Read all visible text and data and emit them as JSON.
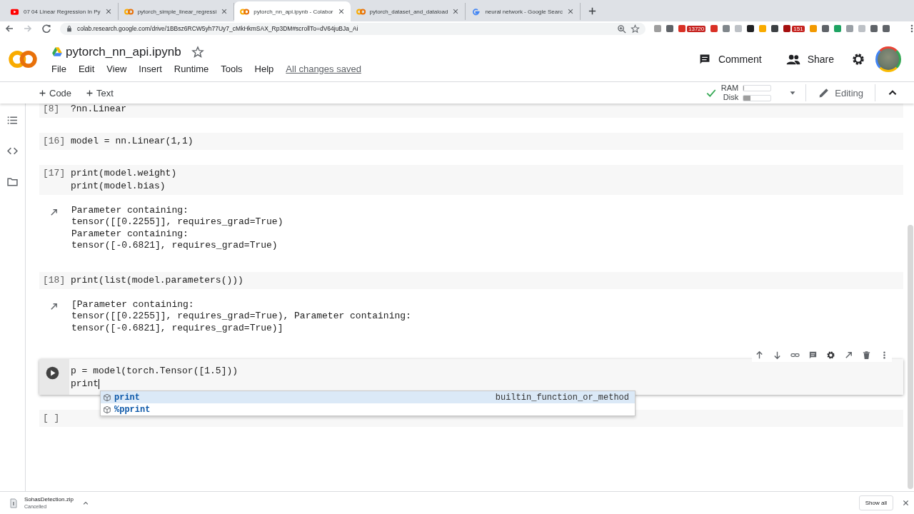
{
  "browser": {
    "tabs": [
      {
        "kind": "video",
        "title": "07 04 Linear Regression In Py",
        "selected": false
      },
      {
        "kind": "colab",
        "title": "pytorch_simple_linear_regressi",
        "selected": false
      },
      {
        "kind": "colab",
        "title": "pytorch_nn_api.ipynb - Colabor",
        "selected": true
      },
      {
        "kind": "colab",
        "title": "pytorch_dataset_and_dataload",
        "selected": false
      },
      {
        "kind": "google",
        "title": "neural network - Google Searc",
        "selected": false
      }
    ],
    "address": "colab.research.google.com/drive/1BBsz6RCW5yh77Uy7_cMkHkmSAX_Rp3DM#scrollTo=dV64juBJa_Ai",
    "extensions": [
      {
        "color": "#9e9e9e"
      },
      {
        "color": "#5f6368"
      },
      {
        "color": "#d93025",
        "badge": "13720"
      },
      {
        "color": "#d93025"
      },
      {
        "color": "#80868b"
      },
      {
        "color": "#bdc1c6"
      },
      {
        "color": "#202124"
      },
      {
        "color": "#f9ab00"
      },
      {
        "color": "#3c4043"
      },
      {
        "color": "#a50e0e",
        "badge": "151"
      },
      {
        "color": "#f29900"
      },
      {
        "color": "#5f6368"
      },
      {
        "color": "#1ea362"
      },
      {
        "color": "#9aa0a6"
      },
      {
        "color": "#bdc1c6"
      },
      {
        "color": "#5f6368"
      },
      {
        "color": "#5f6368"
      }
    ]
  },
  "header": {
    "title": "pytorch_nn_api.ipynb",
    "starred": false,
    "menus": [
      "File",
      "Edit",
      "View",
      "Insert",
      "Runtime",
      "Tools",
      "Help"
    ],
    "save_status": "All changes saved",
    "comment": "Comment",
    "share": "Share"
  },
  "toolbar": {
    "add_buttons": [
      "Code",
      "Text"
    ],
    "connected": true,
    "ram": {
      "label": "RAM",
      "level": 0.03
    },
    "disk": {
      "label": "Disk",
      "level": 0.25
    },
    "mode": "Editing"
  },
  "cells": [
    {
      "kind": "code",
      "prompt": "[8]",
      "lines": [
        "?nn.Linear"
      ]
    },
    {
      "kind": "code",
      "prompt": "[16]",
      "lines": [
        "model = nn.Linear(1,1)"
      ]
    },
    {
      "kind": "code",
      "prompt": "[17]",
      "lines": [
        "print(model.weight)",
        "print(model.bias)"
      ],
      "output": [
        "Parameter containing:",
        "tensor([[0.2255]], requires_grad=True)",
        "Parameter containing:",
        "tensor([-0.6821], requires_grad=True)"
      ]
    },
    {
      "kind": "code",
      "prompt": "[18]",
      "lines": [
        "print(list(model.parameters()))"
      ],
      "output": [
        "[Parameter containing:",
        "tensor([[0.2255]], requires_grad=True), Parameter containing:",
        "tensor([-0.6821], requires_grad=True)]"
      ]
    },
    {
      "kind": "active",
      "lines": [
        "p = model(torch.Tensor([1.5]))",
        "print"
      ],
      "completions": [
        {
          "label": "print",
          "type": "builtin_function_or_method",
          "selected": true
        },
        {
          "label": "%pprint",
          "selected": false
        }
      ]
    },
    {
      "kind": "code",
      "prompt": "[ ]"
    }
  ],
  "downloads": {
    "file": "SohasDetection.zip",
    "status": "Cancelled",
    "show_all": "Show all"
  }
}
